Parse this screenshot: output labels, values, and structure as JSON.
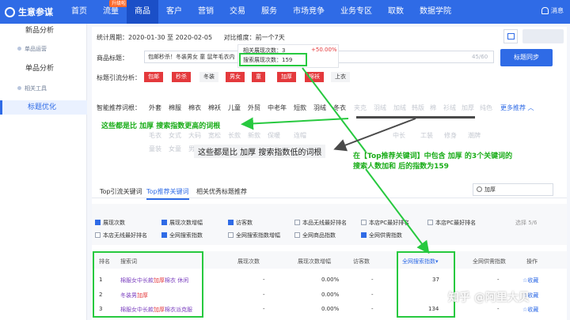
{
  "app": {
    "title": "生意参谋"
  },
  "nav": [
    "首页",
    "流量",
    "商品",
    "客户",
    "营销",
    "交易",
    "服务",
    "市场竞争",
    "业务专区",
    "取数",
    "数据学院"
  ],
  "nav_badge": "升级啦",
  "nav_active_index": 2,
  "message_label": "消息",
  "sidebar": {
    "items": [
      {
        "label": "新品分析",
        "kind": "link"
      },
      {
        "label": "单品运营",
        "kind": "group"
      },
      {
        "label": "单品分析",
        "kind": "link"
      },
      {
        "label": "相关工具",
        "kind": "group"
      },
      {
        "label": "标题优化",
        "kind": "link",
        "active": true
      }
    ]
  },
  "period": {
    "label": "统计周期：",
    "value": "2020-01-30 至 2020-02-05",
    "compare_label": "对比维度：",
    "compare_value": "前一个7天"
  },
  "popup": {
    "line1": "相关展现次数：",
    "line1_value": "3",
    "percent": "+50.00%",
    "line2": "搜索展现次数：",
    "line2_value": "159"
  },
  "title_field": {
    "label": "商品标题：",
    "value": "包邮秒杀！冬装男女 童 鼠年毛衣内",
    "counter": "45/60",
    "sync_button": "标题同步"
  },
  "word_root": {
    "label": "标题引流分析：",
    "tags": [
      {
        "text": "包邮",
        "red": true
      },
      {
        "text": "秒杀",
        "red": true
      },
      {
        "text": "冬装",
        "red": false
      },
      {
        "text": "男女",
        "red": true
      },
      {
        "text": "童",
        "red": true
      },
      {
        "text": "加厚",
        "red": true
      },
      {
        "text": "棉袄",
        "red": true
      },
      {
        "text": "上衣",
        "red": false
      }
    ]
  },
  "smart": {
    "label": "智能推荐词根：",
    "active_words": [
      "外套",
      "棉服",
      "棉衣",
      "棉袄",
      "儿童",
      "外贸",
      "中老年",
      "短款",
      "羽绒",
      "冬衣"
    ],
    "gray_words_row1": [
      "夹克",
      "羽绒",
      "加绒",
      "韩版",
      "棉",
      "衫绒",
      "加厚",
      "纯色",
      "情侣"
    ],
    "gray_words_row2": [
      "毛衣",
      "女式",
      "大码",
      "宽松",
      "长款",
      "新款",
      "保暖",
      "连帽",
      "中长",
      "工装",
      "修身",
      "潮牌"
    ],
    "gray_words_row3": [
      "童装",
      "女童",
      "男童",
      "小",
      "学生",
      "时尚"
    ],
    "more_label": "更多推荐"
  },
  "annotations": {
    "higher": "这些都是比 加厚 搜索指数更高的词根",
    "lower": "这些都是比 加厚 搜索指数低的词根",
    "top_note_line1": "在【Top推荐关键词】中包含 加厚 的3个关键词的",
    "top_note_line2": "搜索人数加和 后的指数为159"
  },
  "tabs": [
    "Top引流关键词",
    "Top推荐关键词",
    "相关优秀标题推荐"
  ],
  "active_tab_index": 1,
  "search_value": "加厚",
  "indicators": [
    {
      "text": "展现次数",
      "on": true
    },
    {
      "text": "展现次数增幅",
      "on": true
    },
    {
      "text": "访客数",
      "on": true
    },
    {
      "text": "本品无线最好排名",
      "on": false
    },
    {
      "text": "本店PC最好排名",
      "on": false
    },
    {
      "text": "本店PC最好排名",
      "on": false
    },
    {
      "text": "本店无线最好排名",
      "on": false
    },
    {
      "text": "全网搜索指数",
      "on": true
    },
    {
      "text": "全网搜索指数增幅",
      "on": false
    },
    {
      "text": "全网商品指数",
      "on": false
    },
    {
      "text": "全网供需指数",
      "on": true
    }
  ],
  "selected_count": "选择 5/6",
  "table": {
    "headers": [
      "排名",
      "搜索词",
      "展现次数",
      "展现次数增幅",
      "访客数",
      "全网搜索指数",
      "全网供需指数",
      "操作"
    ],
    "rows": [
      {
        "rank": "1",
        "pre": "棉服女中长款",
        "hl": "加厚",
        "post": "棉衣 休闲",
        "views": "-",
        "growth": "0.00%",
        "visitors": "-",
        "search_index": "37",
        "supply_index": "-",
        "action": "收藏"
      },
      {
        "rank": "2",
        "pre": "冬装男",
        "hl": "加厚",
        "post": "",
        "views": "-",
        "growth": "0.00%",
        "visitors": "-",
        "search_index": "",
        "supply_index": "-",
        "action": "收藏"
      },
      {
        "rank": "3",
        "pre": "棉服女中长款",
        "hl": "加厚",
        "post": "棉衣派克服",
        "views": "-",
        "growth": "0.00%",
        "visitors": "-",
        "search_index": "134",
        "supply_index": "-",
        "action": "收藏"
      }
    ]
  },
  "watermark": "知乎 @阿里大贝",
  "colors": {
    "primary": "#2f6be6",
    "red": "#e4393c",
    "annotation_green": "#27c93f"
  }
}
